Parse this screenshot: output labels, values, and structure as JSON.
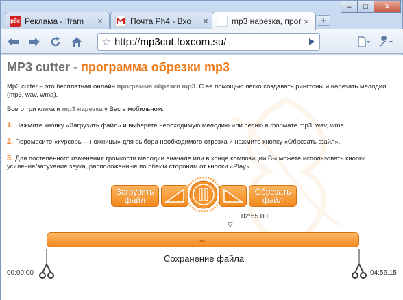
{
  "browser": {
    "tabs": [
      {
        "favicon": "рбк",
        "title": "Реклама - Ifram",
        "close": "×",
        "favicon_color": "#d12020"
      },
      {
        "favicon": "M",
        "title": "Почта Ph4 - Вхо",
        "close": "×",
        "favicon_color": "#ffffff"
      },
      {
        "favicon": "",
        "title": "mp3 нарезка, прог",
        "close": "×",
        "favicon_color": "#ffffff"
      }
    ],
    "new_tab": "+",
    "window_buttons": {
      "minimize": "–",
      "maximize": "□",
      "close": "✕"
    },
    "url_scheme": "http://",
    "url_host": "mp3cut.foxcom.su",
    "url_path": "/",
    "icons": {
      "back": "back-arrow-icon",
      "forward": "forward-arrow-icon",
      "reload": "reload-icon",
      "home": "home-icon",
      "bookmark": "star-icon",
      "go": "play-go-icon",
      "page_menu": "page-menu-icon",
      "wrench": "wrench-icon"
    }
  },
  "page": {
    "title_prefix": "MP3 cutter - ",
    "title_accent": "программа обрезки mp3",
    "intro_a": "Mp3 cutter – это бесплатная онлайн ",
    "intro_b": "программа обрезки mp3",
    "intro_c": ". С ее помощью легко создавать рингтоны и нарезать мелодии (mp3, wav, wma).",
    "line2_a": "Всего три клика и ",
    "line2_b": "mp3 нарезка",
    "line2_c": " у Вас в мобильном.",
    "steps": [
      {
        "num": "1.",
        "text": "Нажмите кнопку «Загрузить файл» и выберете необходимую мелодию или песню в формате mp3, wav, wma."
      },
      {
        "num": "2.",
        "text": "Перемесите «курсоры – ножницы» для выбора необходимого отрезка и нажмите кнопку «Обрезать файл»."
      },
      {
        "num": "3.",
        "text": "Для постепенного изменения громкости мелодии вначале или в конце композиции Вы можете использовать кнопки усиление/затухание звука, расположенные по обеим сторонам от кнопки «Play»."
      }
    ],
    "buttons": {
      "upload": "Загрузить файл",
      "cut": "Обрезать файл"
    },
    "current_time": "02:55.00",
    "marker": "▽",
    "save_label": "Сохранение файла",
    "start_time": "00:00.00",
    "end_time": "04:56.15",
    "accent_color": "#ef7a17"
  }
}
